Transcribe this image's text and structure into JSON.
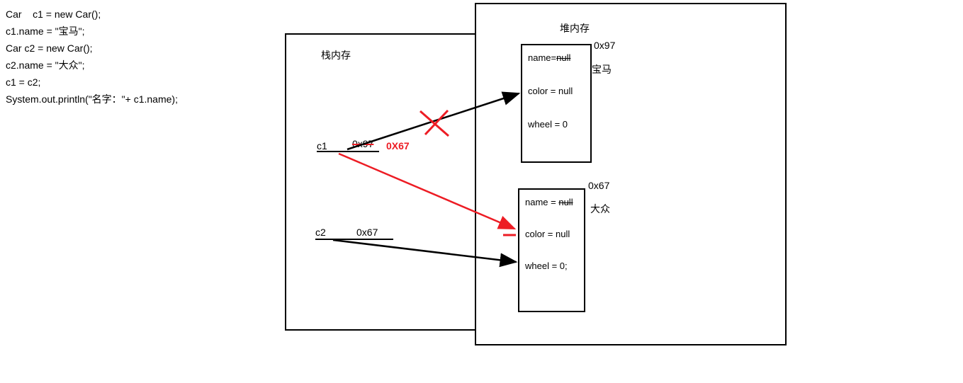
{
  "code": {
    "line1": "Car    c1 = new Car();",
    "line2": "c1.name = \"宝马\";",
    "line3": "Car c2 = new Car();",
    "line4": "c2.name = \"大众\";",
    "line5": "c1 = c2;",
    "line6": "System.out.println(\"名字：\"+ c1.name);"
  },
  "stack": {
    "title": "栈内存",
    "c1": {
      "label": "c1",
      "addr_old": "0x97",
      "addr_new": "0X67"
    },
    "c2": {
      "label": "c2",
      "addr": "0x67"
    }
  },
  "heap": {
    "title": "堆内存",
    "obj1": {
      "address": "0x97",
      "name_prefix": "name=",
      "name_null": "null",
      "name_value": "宝马",
      "color": "color = null",
      "wheel": "wheel = 0"
    },
    "obj2": {
      "address": "0x67",
      "name_prefix": "name = ",
      "name_null": "null",
      "name_value": "大众",
      "color": "color = null",
      "wheel": "wheel = 0;"
    }
  }
}
